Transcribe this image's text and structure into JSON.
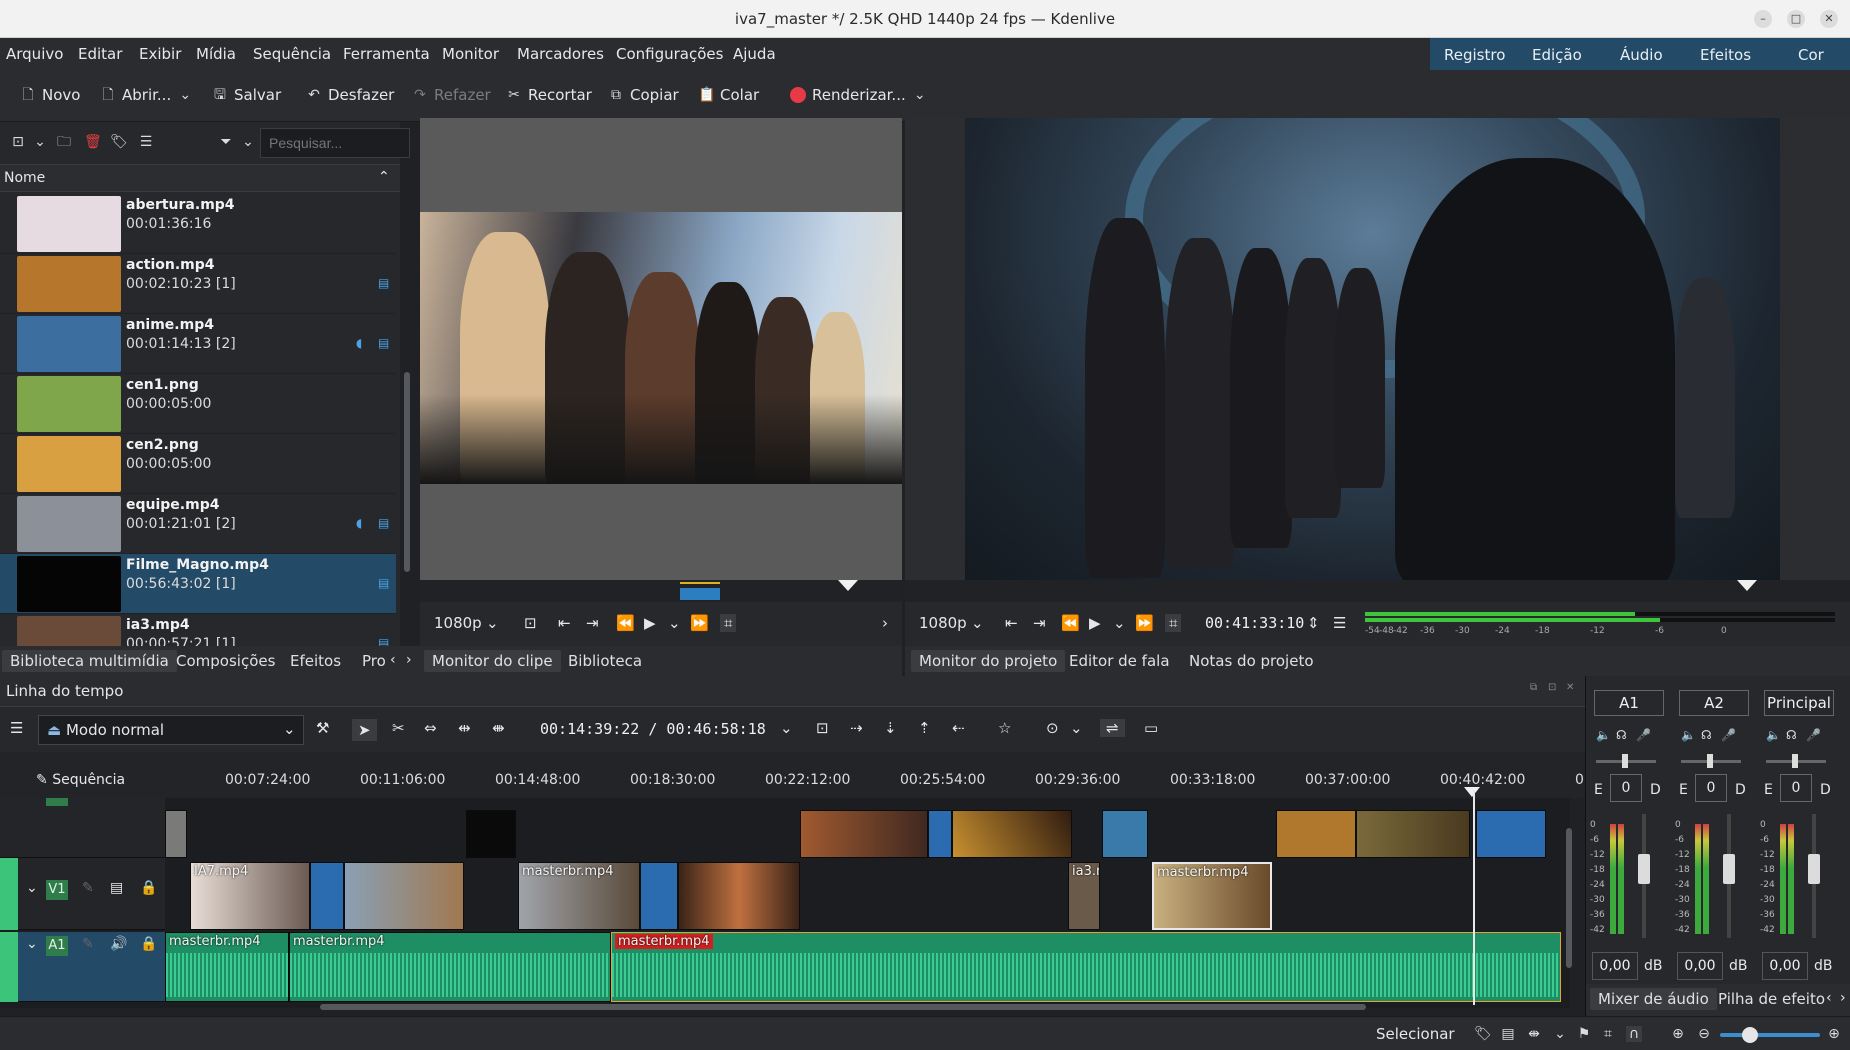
{
  "window": {
    "title": "iva7_master */ 2.5K QHD 1440p 24 fps — Kdenlive"
  },
  "menu": [
    "Arquivo",
    "Editar",
    "Exibir",
    "Mídia",
    "Sequência",
    "Ferramenta",
    "Monitor",
    "Marcadores",
    "Configurações",
    "Ajuda"
  ],
  "workspaces": [
    "Registro",
    "Edição",
    "Áudio",
    "Efeitos",
    "Cor"
  ],
  "toolbar": {
    "new": "Novo",
    "open": "Abrir...",
    "save": "Salvar",
    "undo": "Desfazer",
    "redo": "Refazer",
    "cut": "Recortar",
    "copy": "Copiar",
    "paste": "Colar",
    "render": "Renderizar..."
  },
  "bin": {
    "search_placeholder": "Pesquisar...",
    "header": "Nome",
    "clips": [
      {
        "name": "abertura.mp4",
        "duration": "00:01:36:16",
        "thumb": "#e6dbe0"
      },
      {
        "name": "action.mp4",
        "duration": "00:02:10:23 [1]",
        "thumb": "#b6772c"
      },
      {
        "name": "anime.mp4",
        "duration": "00:01:14:13 [2]",
        "thumb": "#3d6ea0"
      },
      {
        "name": "cen1.png",
        "duration": "00:00:05:00",
        "thumb": "#7fa64a"
      },
      {
        "name": "cen2.png",
        "duration": "00:00:05:00",
        "thumb": "#d8a040"
      },
      {
        "name": "equipe.mp4",
        "duration": "00:01:21:01 [2]",
        "thumb": "#8c9098"
      },
      {
        "name": "Filme_Magno.mp4",
        "duration": "00:56:43:02 [1]",
        "thumb": "#050505"
      },
      {
        "name": "ia3.mp4",
        "duration": "00:00:57:21 [1]",
        "thumb": "#6a4a38"
      }
    ]
  },
  "bottom_tabs_left": [
    "Biblioteca multimídia",
    "Composições",
    "Efeitos",
    "Pro"
  ],
  "clip_monitor": {
    "resolution": "1080p",
    "tabs": [
      "Monitor do clipe",
      "Biblioteca"
    ]
  },
  "project_monitor": {
    "resolution": "1080p",
    "timecode": "00:41:33:10",
    "meter_labels": [
      "-54",
      "-48",
      "-42",
      "-36",
      "-30",
      "-24",
      "-18",
      "-12",
      "-6",
      "0"
    ],
    "tabs": [
      "Monitor do projeto",
      "Editor de fala",
      "Notas do projeto"
    ]
  },
  "timeline": {
    "title": "Linha do tempo",
    "mode": "Modo normal",
    "position": "00:14:39:22 / 00:46:58:18",
    "sequence_label": "Sequência",
    "ruler": [
      "00:07:24:00",
      "00:11:06:00",
      "00:14:48:00",
      "00:18:30:00",
      "00:22:12:00",
      "00:25:54:00",
      "00:29:36:00",
      "00:33:18:00",
      "00:37:00:00",
      "00:40:42:00",
      "0"
    ],
    "tracks": {
      "v1": "V1",
      "a1": "A1"
    },
    "clips": {
      "ia7": "IA7.mp4",
      "masterbr1": "masterbr.mp4",
      "ia3": "ia3.r",
      "masterbr2": "masterbr.mp4",
      "a_master1": "masterbr.mp4",
      "a_master2": "masterbr.mp4",
      "a_master3": "masterbr.mp4"
    }
  },
  "mixer": {
    "channels": [
      {
        "name": "A1",
        "gain": "0",
        "db": "0,00"
      },
      {
        "name": "A2",
        "gain": "0",
        "db": "0,00"
      },
      {
        "name": "Principal",
        "gain": "0",
        "db": "0,00"
      }
    ],
    "db_unit": "dB",
    "ed_left": "E",
    "ed_right": "D",
    "scale": [
      "0",
      "-6",
      "-12",
      "-18",
      "-24",
      "-30",
      "-36",
      "-42"
    ],
    "tabs": [
      "Mixer de áudio",
      "Pilha de efeito"
    ]
  },
  "status": {
    "tool": "Selecionar"
  }
}
